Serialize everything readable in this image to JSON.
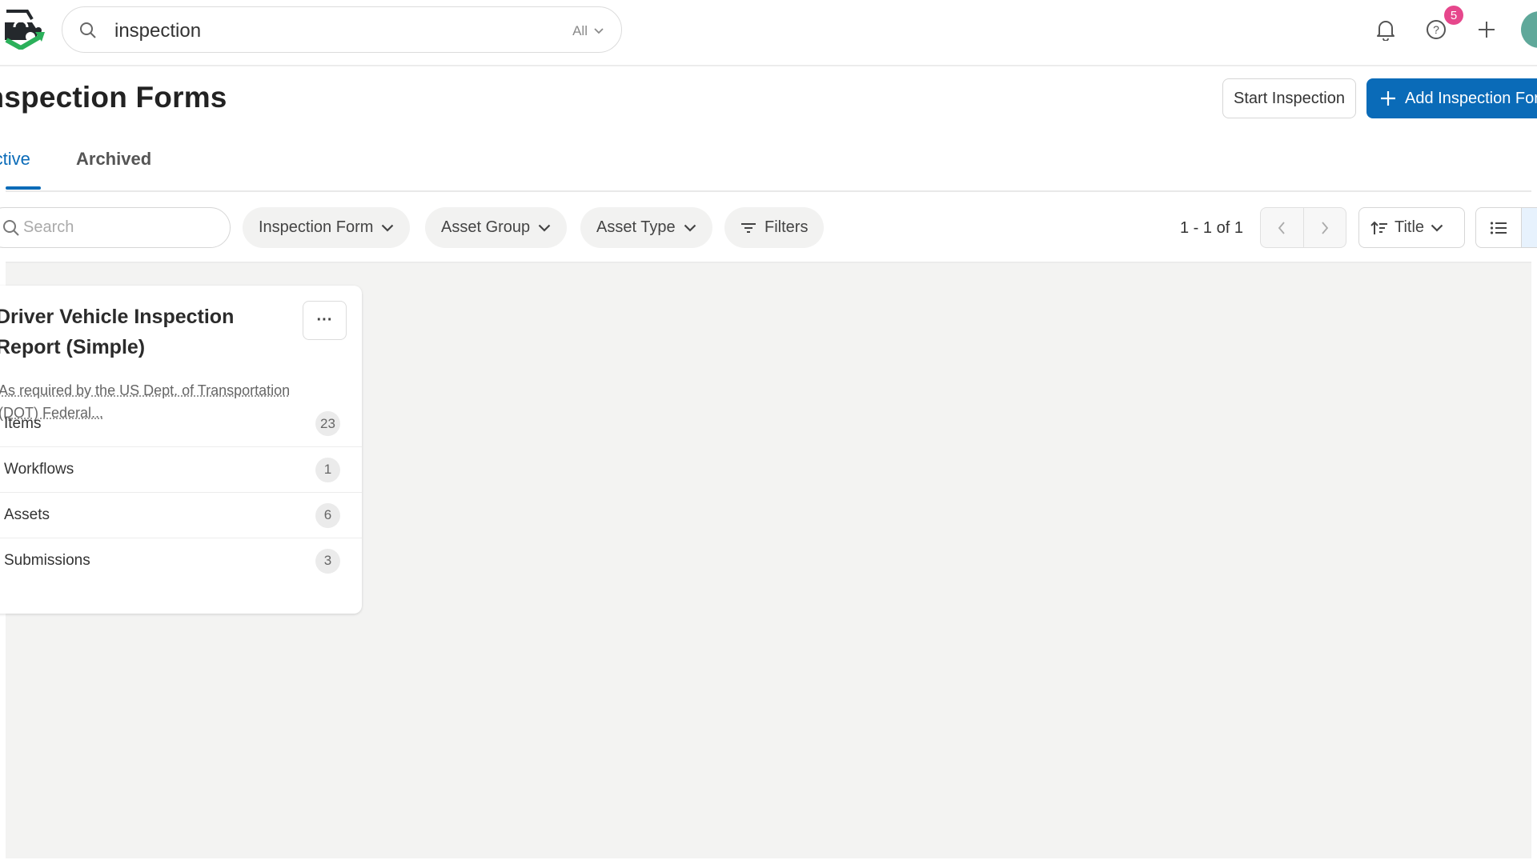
{
  "topbar": {
    "logo_icon": "fleet-logo-icon",
    "search": {
      "value": "inspection",
      "scope": "All",
      "icon": "search-icon"
    },
    "icons": [
      {
        "name": "notifications",
        "icon": "bell-icon"
      },
      {
        "name": "help",
        "icon": "question-circle-icon",
        "badge": "5"
      },
      {
        "name": "add",
        "icon": "plus-icon"
      }
    ],
    "avatar": {
      "color": "#5fa89a"
    }
  },
  "page": {
    "title": "Inspection Forms",
    "actions": {
      "start_inspection": "Start Inspection",
      "add_inspection_form": "Add Inspection Form"
    },
    "tabs": [
      {
        "label": "Active",
        "active": true
      },
      {
        "label": "Archived",
        "active": false
      }
    ]
  },
  "filters": {
    "search_placeholder": "Search",
    "chips": [
      "Inspection Form",
      "Asset Group",
      "Asset Type"
    ],
    "more_filters": "Filters",
    "pagination": {
      "text": "1 - 1 of 1"
    },
    "sort": {
      "label": "Title"
    }
  },
  "cards": [
    {
      "title": "Driver Vehicle Inspection Report (Simple)",
      "description": "As required by the US Dept. of Transportation (DOT) Federal...",
      "stats": [
        {
          "label": "Items",
          "count": "23"
        },
        {
          "label": "Workflows",
          "count": "1"
        },
        {
          "label": "Assets",
          "count": "6"
        },
        {
          "label": "Submissions",
          "count": "3"
        }
      ]
    }
  ],
  "colors": {
    "primary": "#0a6bb8",
    "badge": "#e6478c",
    "content_bg": "#f3f3f2",
    "logo_green": "#2bb05a",
    "logo_dark": "#24282c"
  }
}
